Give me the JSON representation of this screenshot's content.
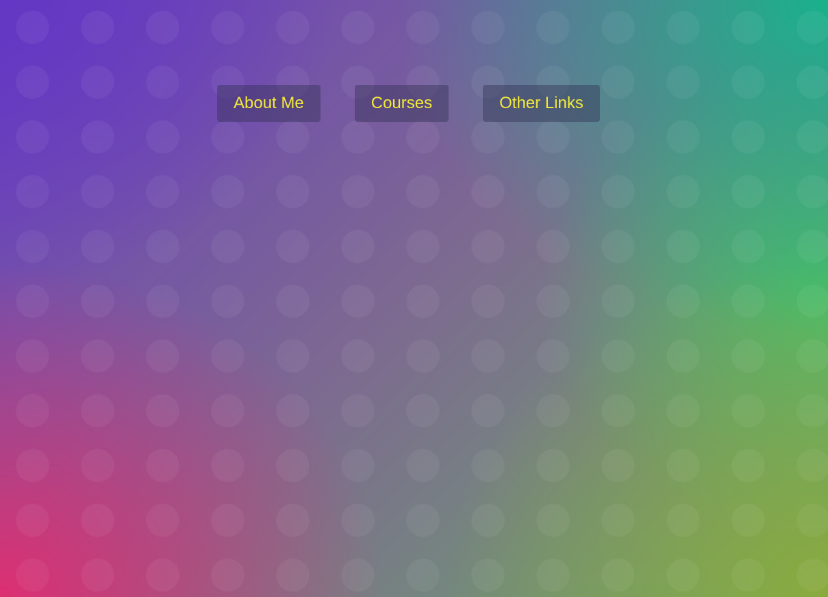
{
  "nav": {
    "items": [
      {
        "label": "About Me"
      },
      {
        "label": "Courses"
      },
      {
        "label": "Other Links"
      }
    ]
  },
  "colors": {
    "button_text": "#f3e93a",
    "button_background": "rgba(48,48,80,0.42)",
    "gradient_top_left": "#6437c4",
    "gradient_top_right": "#14b48c",
    "gradient_bottom_left": "#e22c70",
    "gradient_bottom_right": "#8caa3c"
  }
}
